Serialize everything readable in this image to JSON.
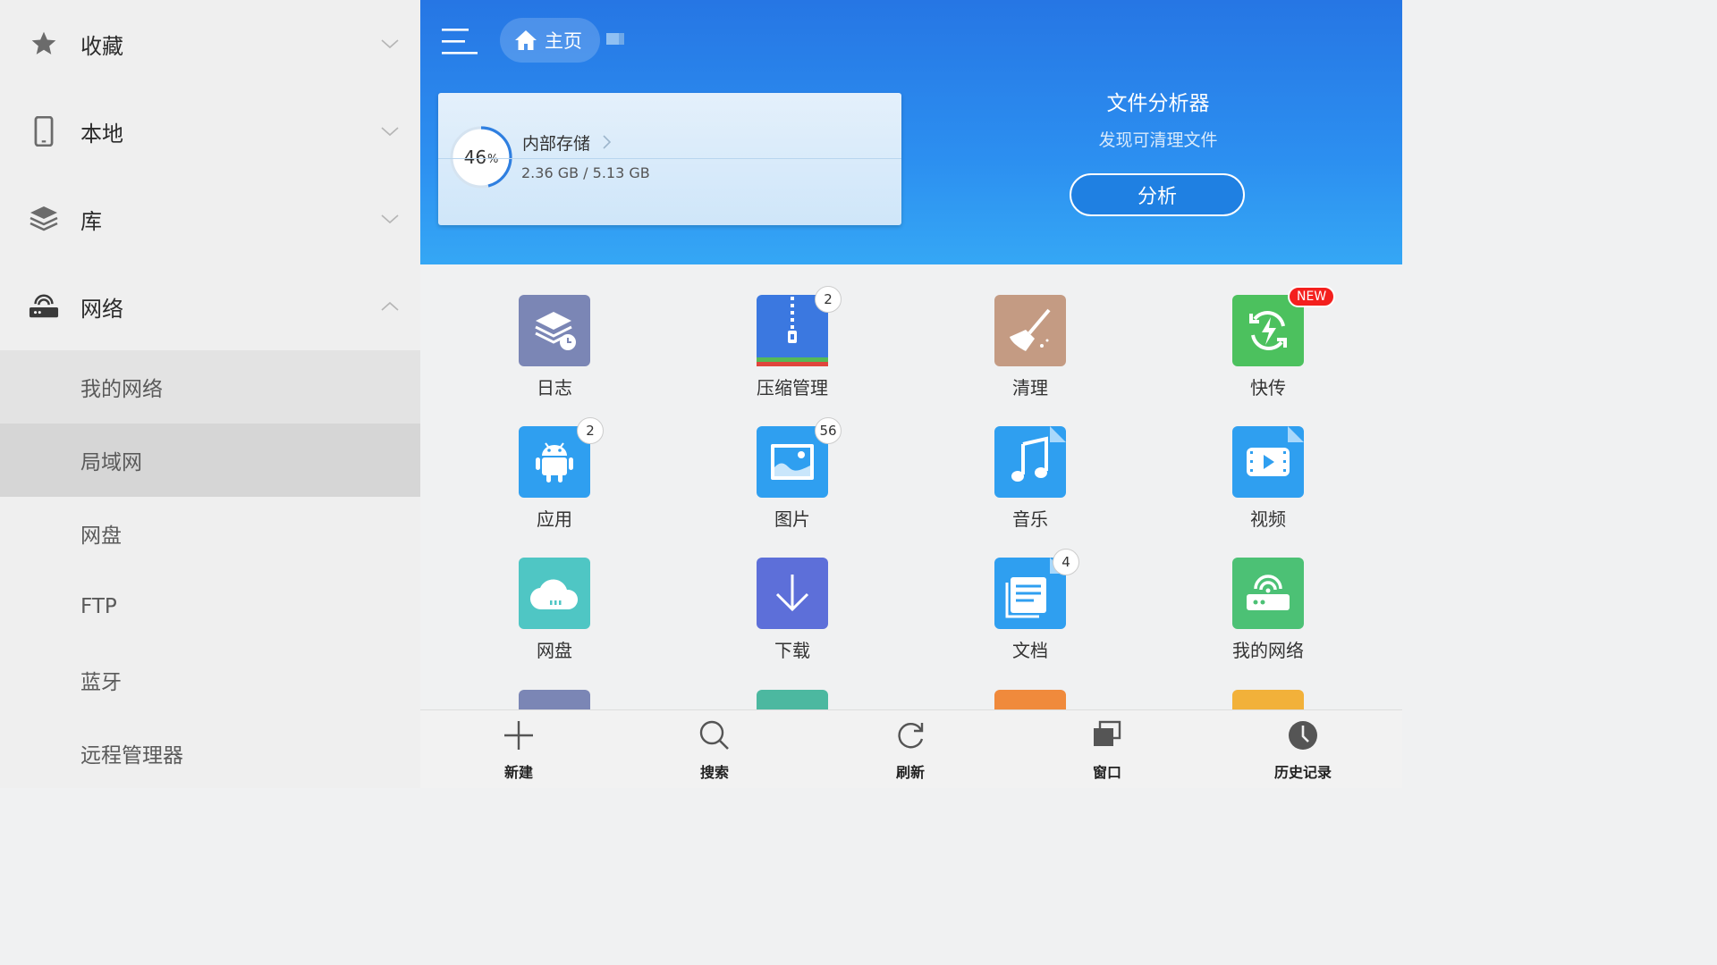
{
  "sidebar": {
    "sections": [
      {
        "label": "收藏",
        "icon": "star-icon",
        "expanded": false
      },
      {
        "label": "本地",
        "icon": "phone-icon",
        "expanded": false
      },
      {
        "label": "库",
        "icon": "layers-icon",
        "expanded": false
      },
      {
        "label": "网络",
        "icon": "router-icon",
        "expanded": true
      }
    ],
    "network_items": [
      "我的网络",
      "局域网",
      "网盘",
      "FTP",
      "蓝牙",
      "远程管理器"
    ],
    "active_item": "局域网"
  },
  "header": {
    "home_label": "主页",
    "storage": {
      "title": "内部存储",
      "percent": "46",
      "percent_unit": "%",
      "percent_value": 0.46,
      "size": "2.36 GB / 5.13 GB"
    },
    "analyzer": {
      "title": "文件分析器",
      "subtitle": "发现可清理文件",
      "button": "分析"
    }
  },
  "grid": {
    "tiles": [
      {
        "label": "日志",
        "icon": "log-icon",
        "color": "#7b86b5",
        "badge": ""
      },
      {
        "label": "压缩管理",
        "icon": "zip-icon",
        "color": "#3b78e0",
        "badge": "2"
      },
      {
        "label": "清理",
        "icon": "broom-icon",
        "color": "#c49b83",
        "badge": ""
      },
      {
        "label": "快传",
        "icon": "quick-transfer-icon",
        "color": "#4cc15e",
        "badge": "NEW"
      },
      {
        "label": "应用",
        "icon": "android-icon",
        "color": "#2f9ff0",
        "badge": "2"
      },
      {
        "label": "图片",
        "icon": "image-icon",
        "color": "#2f9ff0",
        "badge": "56"
      },
      {
        "label": "音乐",
        "icon": "music-icon",
        "color": "#2f9ff0",
        "badge": ""
      },
      {
        "label": "视频",
        "icon": "video-icon",
        "color": "#2f9ff0",
        "badge": ""
      },
      {
        "label": "网盘",
        "icon": "cloud-icon",
        "color": "#4fc6c4",
        "badge": ""
      },
      {
        "label": "下载",
        "icon": "download-icon",
        "color": "#5d6fd9",
        "badge": ""
      },
      {
        "label": "文档",
        "icon": "document-icon",
        "color": "#2f9ff0",
        "badge": "4"
      },
      {
        "label": "我的网络",
        "icon": "network-icon",
        "color": "#4cc175",
        "badge": ""
      }
    ],
    "peek_colors": [
      "#7b86b5",
      "#4cb8a0",
      "#f08a3c",
      "#f2b13a"
    ]
  },
  "bottombar": [
    {
      "label": "新建",
      "icon": "plus-icon"
    },
    {
      "label": "搜索",
      "icon": "search-icon"
    },
    {
      "label": "刷新",
      "icon": "refresh-icon"
    },
    {
      "label": "窗口",
      "icon": "windows-icon"
    },
    {
      "label": "历史记录",
      "icon": "history-icon"
    }
  ]
}
